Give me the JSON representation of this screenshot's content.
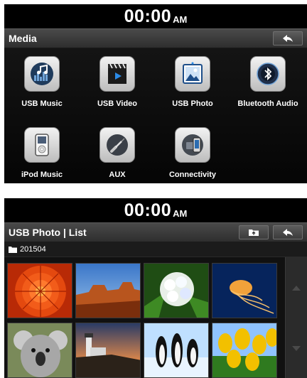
{
  "screen_media": {
    "clock": {
      "time": "00:00",
      "ampm": "AM"
    },
    "title": "Media",
    "back_icon": "back-arrow-icon",
    "apps": [
      {
        "label": "USB Music",
        "icon": "usb-music-icon"
      },
      {
        "label": "USB Video",
        "icon": "usb-video-icon"
      },
      {
        "label": "USB Photo",
        "icon": "usb-photo-icon"
      },
      {
        "label": "Bluetooth Audio",
        "icon": "bluetooth-icon"
      },
      {
        "label": "iPod Music",
        "icon": "ipod-icon"
      },
      {
        "label": "AUX",
        "icon": "aux-cable-icon"
      },
      {
        "label": "Connectivity",
        "icon": "phone-connectivity-icon"
      }
    ]
  },
  "screen_photo_list": {
    "clock": {
      "time": "00:00",
      "ampm": "AM"
    },
    "title": "USB Photo | List",
    "folder_button_icon": "folder-up-icon",
    "back_icon": "back-arrow-icon",
    "folder": {
      "icon": "folder-icon",
      "name": "201504"
    },
    "thumbnails": [
      {
        "subject": "red-chrysanthemum"
      },
      {
        "subject": "desert-mesa"
      },
      {
        "subject": "white-hydrangea"
      },
      {
        "subject": "jellyfish"
      },
      {
        "subject": "koala"
      },
      {
        "subject": "lighthouse"
      },
      {
        "subject": "penguins"
      },
      {
        "subject": "tulips"
      }
    ],
    "scroll": {
      "up_icon": "scroll-up-icon",
      "down_icon": "scroll-down-icon"
    }
  },
  "colors": {
    "screen_bg": "#0d0d0d",
    "titlebar": "#3a3a3a",
    "text": "#ffffff",
    "icon_bg": "#d9d9d9"
  }
}
